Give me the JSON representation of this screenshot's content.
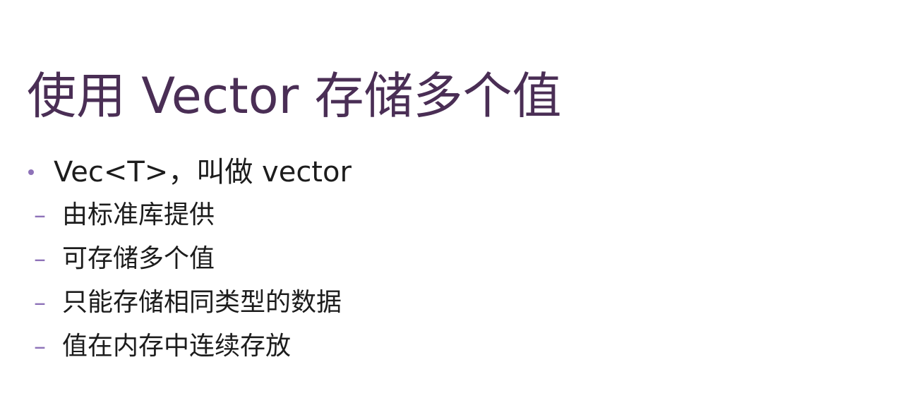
{
  "slide": {
    "title": "使用 Vector 存储多个值",
    "bullet": {
      "text": "Vec<T>，叫做 vector",
      "sub_items": [
        {
          "dash": "–",
          "text": "由标准库提供"
        },
        {
          "dash": "–",
          "text": "可存储多个值"
        },
        {
          "dash": "–",
          "text": "只能存储相同类型的数据"
        },
        {
          "dash": "–",
          "text": "值在内存中连续存放"
        }
      ]
    },
    "colors": {
      "title": "#4a2e55",
      "bullet_accent": "#8e72b8",
      "body_text": "#1c1c1c",
      "background": "#ffffff"
    }
  }
}
